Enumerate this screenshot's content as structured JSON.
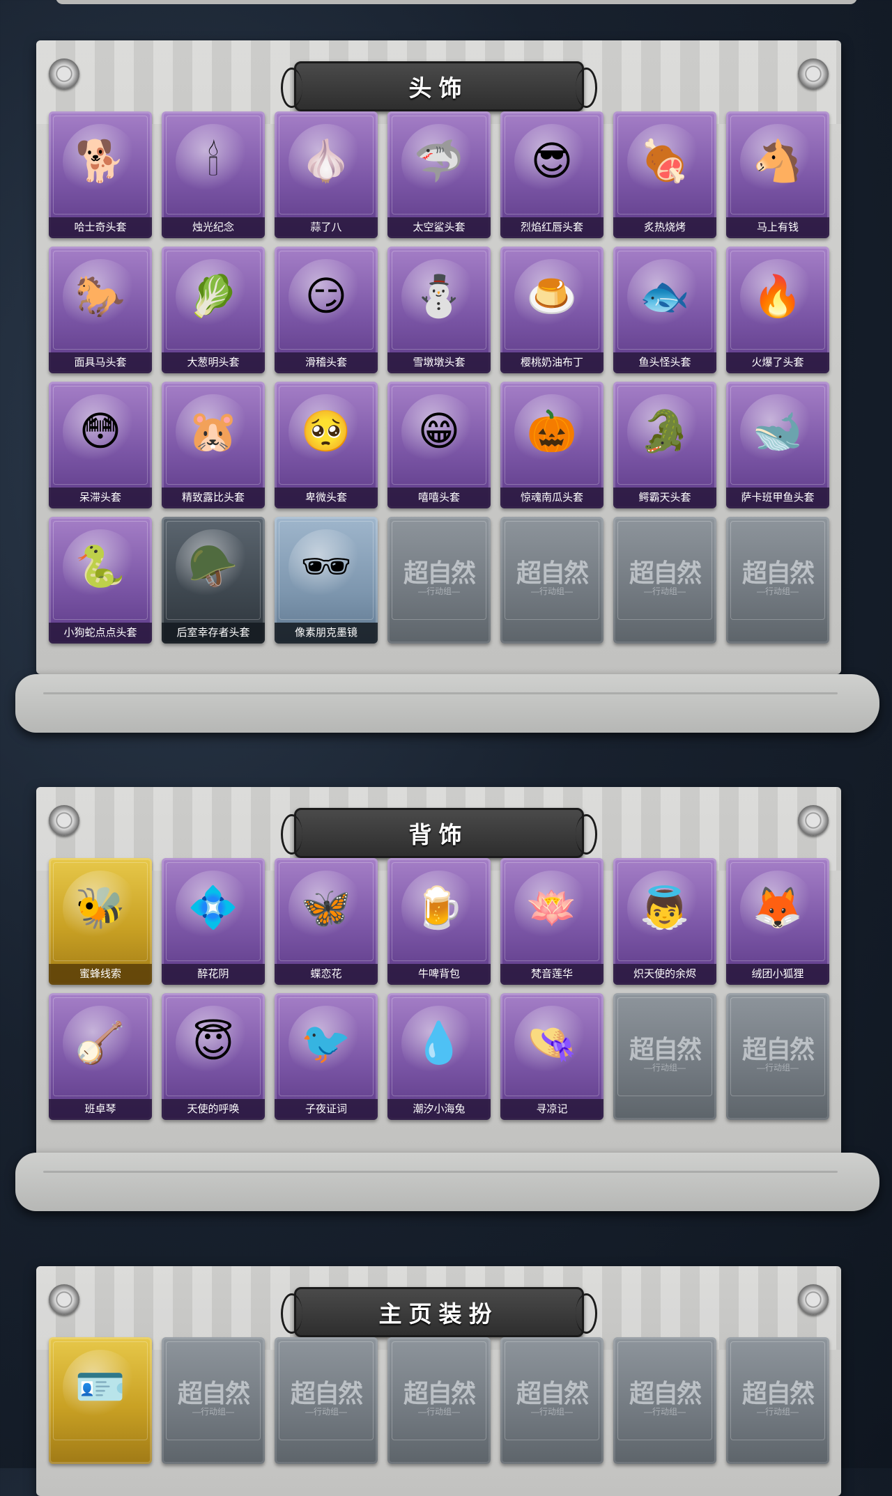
{
  "sections": [
    {
      "title": "头饰",
      "items": [
        {
          "label": "哈士奇头套",
          "icon": "dog-mask-icon",
          "glyph": "🐕",
          "style": "purple"
        },
        {
          "label": "烛光纪念",
          "icon": "candle-icon",
          "glyph": "🕯",
          "style": "purple"
        },
        {
          "label": "蒜了八",
          "icon": "garlic-icon",
          "glyph": "🧄",
          "style": "purple"
        },
        {
          "label": "太空鲨头套",
          "icon": "shark-icon",
          "glyph": "🦈",
          "style": "purple"
        },
        {
          "label": "烈焰红唇头套",
          "icon": "pikachu-mask-icon",
          "glyph": "😎",
          "style": "purple"
        },
        {
          "label": "炙热烧烤",
          "icon": "bbq-meat-icon",
          "glyph": "🍖",
          "style": "purple"
        },
        {
          "label": "马上有钱",
          "icon": "red-horse-icon",
          "glyph": "🐴",
          "style": "purple"
        },
        {
          "label": "面具马头套",
          "icon": "horse-mask-icon",
          "glyph": "🐎",
          "style": "purple"
        },
        {
          "label": "大葱明头套",
          "icon": "scallion-icon",
          "glyph": "🥬",
          "style": "purple"
        },
        {
          "label": "滑稽头套",
          "icon": "smirk-face-icon",
          "glyph": "😏",
          "style": "purple"
        },
        {
          "label": "雪墩墩头套",
          "icon": "snowman-icon",
          "glyph": "⛄",
          "style": "purple"
        },
        {
          "label": "樱桃奶油布丁",
          "icon": "pudding-icon",
          "glyph": "🍮",
          "style": "purple"
        },
        {
          "label": "鱼头怪头套",
          "icon": "fish-head-icon",
          "glyph": "🐟",
          "style": "purple"
        },
        {
          "label": "火爆了头套",
          "icon": "fire-icon",
          "glyph": "🔥",
          "style": "purple"
        },
        {
          "label": "呆滞头套",
          "icon": "dazed-face-icon",
          "glyph": "😳",
          "style": "purple"
        },
        {
          "label": "精致露比头套",
          "icon": "pink-beaver-icon",
          "glyph": "🐹",
          "style": "purple"
        },
        {
          "label": "卑微头套",
          "icon": "humble-face-icon",
          "glyph": "🥺",
          "style": "purple"
        },
        {
          "label": "嘻嘻头套",
          "icon": "grin-face-icon",
          "glyph": "😁",
          "style": "purple"
        },
        {
          "label": "惊魂南瓜头套",
          "icon": "pumpkin-icon",
          "glyph": "🎃",
          "style": "purple"
        },
        {
          "label": "鳄霸天头套",
          "icon": "crocodile-icon",
          "glyph": "🐊",
          "style": "purple"
        },
        {
          "label": "萨卡班甲鱼头套",
          "icon": "armored-fish-icon",
          "glyph": "🐋",
          "style": "purple"
        },
        {
          "label": "小狗蛇点点头套",
          "icon": "snake-icon",
          "glyph": "🐍",
          "style": "purple"
        },
        {
          "label": "后室幸存者头套",
          "icon": "gas-mask-icon",
          "glyph": "🪖",
          "style": "dark"
        },
        {
          "label": "像素朋克墨镜",
          "icon": "pixel-sunglasses-icon",
          "glyph": "🕶",
          "style": "blue"
        },
        {
          "label": "",
          "icon": "empty-slot-icon",
          "style": "empty"
        },
        {
          "label": "",
          "icon": "empty-slot-icon",
          "style": "empty"
        },
        {
          "label": "",
          "icon": "empty-slot-icon",
          "style": "empty"
        },
        {
          "label": "",
          "icon": "empty-slot-icon",
          "style": "empty"
        }
      ]
    },
    {
      "title": "背饰",
      "items": [
        {
          "label": "蜜蜂线索",
          "icon": "bee-beaver-icon",
          "glyph": "🐝",
          "style": "gold"
        },
        {
          "label": "醉花阴",
          "icon": "flower-ornament-icon",
          "glyph": "💠",
          "style": "purple"
        },
        {
          "label": "蝶恋花",
          "icon": "butterfly-bell-icon",
          "glyph": "🦋",
          "style": "purple"
        },
        {
          "label": "牛啤背包",
          "icon": "beer-cow-icon",
          "glyph": "🍺",
          "style": "purple"
        },
        {
          "label": "梵音莲华",
          "icon": "lotus-girl-icon",
          "glyph": "🪷",
          "style": "purple"
        },
        {
          "label": "炽天使的余烬",
          "icon": "angel-doll-icon",
          "glyph": "👼",
          "style": "purple"
        },
        {
          "label": "绒团小狐狸",
          "icon": "fox-icon",
          "glyph": "🦊",
          "style": "purple"
        },
        {
          "label": "班卓琴",
          "icon": "banjo-beaver-icon",
          "glyph": "🪕",
          "style": "purple"
        },
        {
          "label": "天使的呼唤",
          "icon": "cherub-icon",
          "glyph": "😇",
          "style": "purple"
        },
        {
          "label": "子夜证词",
          "icon": "crow-doctor-icon",
          "glyph": "🐦",
          "style": "purple"
        },
        {
          "label": "潮汐小海兔",
          "icon": "blue-creature-icon",
          "glyph": "💧",
          "style": "purple"
        },
        {
          "label": "寻凉记",
          "icon": "sunhat-beaver-icon",
          "glyph": "👒",
          "style": "purple"
        },
        {
          "label": "",
          "icon": "empty-slot-icon",
          "style": "empty"
        },
        {
          "label": "",
          "icon": "empty-slot-icon",
          "style": "empty"
        }
      ]
    },
    {
      "title": "主页装扮",
      "items": [
        {
          "label": "",
          "icon": "profile-card-icon",
          "glyph": "🪪",
          "style": "gold"
        },
        {
          "label": "",
          "icon": "empty-slot-icon",
          "style": "empty"
        },
        {
          "label": "",
          "icon": "empty-slot-icon",
          "style": "empty"
        },
        {
          "label": "",
          "icon": "empty-slot-icon",
          "style": "empty"
        },
        {
          "label": "",
          "icon": "empty-slot-icon",
          "style": "empty"
        },
        {
          "label": "",
          "icon": "empty-slot-icon",
          "style": "empty"
        },
        {
          "label": "",
          "icon": "empty-slot-icon",
          "style": "empty"
        }
      ]
    }
  ],
  "watermark": {
    "main": "超自然",
    "sub": "—行动组—"
  }
}
